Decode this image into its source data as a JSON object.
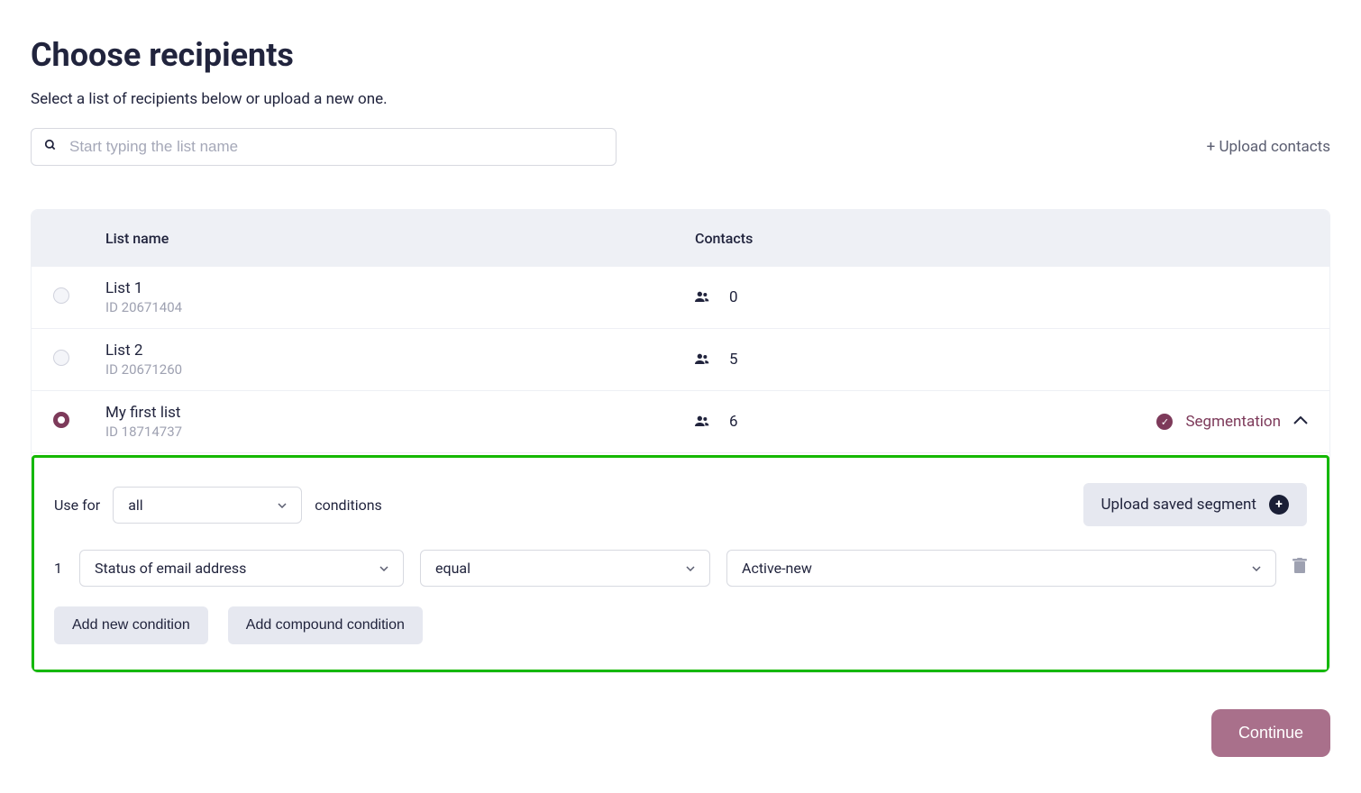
{
  "header": {
    "title": "Choose recipients",
    "subtitle": "Select a list of recipients below or upload a new one."
  },
  "search": {
    "placeholder": "Start typing the list name"
  },
  "upload_contacts": "+ Upload contacts",
  "table": {
    "columns": {
      "name": "List name",
      "contacts": "Contacts"
    },
    "rows": [
      {
        "name": "List 1",
        "id": "ID 20671404",
        "contacts": "0",
        "selected": false,
        "segmentation": false
      },
      {
        "name": "List 2",
        "id": "ID 20671260",
        "contacts": "5",
        "selected": false,
        "segmentation": false
      },
      {
        "name": "My first list",
        "id": "ID 18714737",
        "contacts": "6",
        "selected": true,
        "segmentation": true
      }
    ]
  },
  "segmentation": {
    "use_for": "Use for",
    "all": "all",
    "conditions_label": "conditions",
    "upload_saved": "Upload saved segment",
    "condition": {
      "num": "1",
      "field": "Status of email address",
      "operator": "equal",
      "value": "Active-new"
    },
    "add_condition": "Add new condition",
    "add_compound": "Add compound condition",
    "seg_label": "Segmentation"
  },
  "continue": "Continue"
}
